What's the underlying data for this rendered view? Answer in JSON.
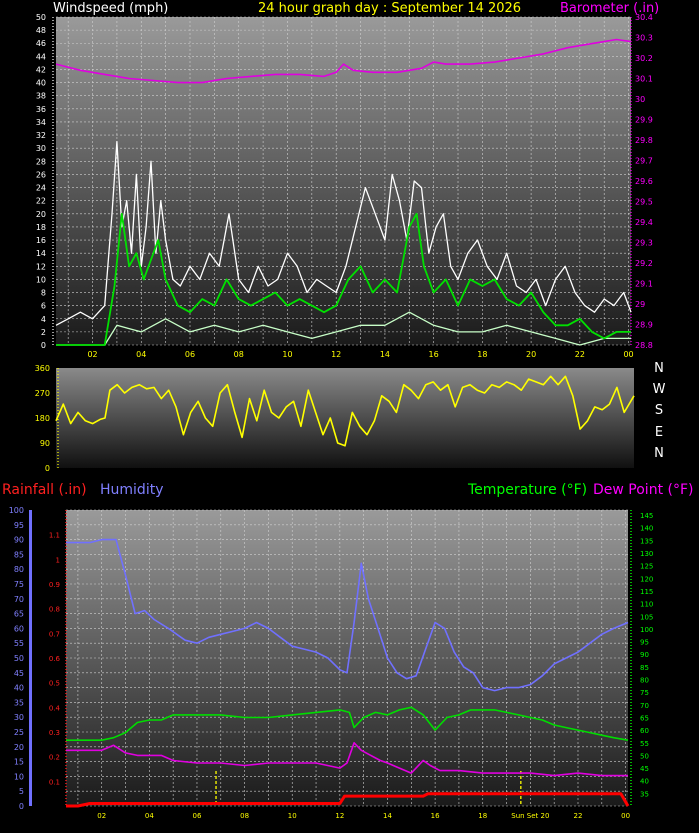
{
  "header": {
    "windspeed_label": "Windspeed (mph)",
    "graph_title": "24 hour graph day : September 14 2026",
    "barometer_label": "Barometer (.in)"
  },
  "compass": [
    "N",
    "W",
    "S",
    "E",
    "N"
  ],
  "legend2": {
    "rainfall": "Rainfall (.in)",
    "humidity": "Humidity",
    "temperature": "Temperature (°F)",
    "dewpoint": "Dew Point (°F)"
  },
  "colors": {
    "windspeed": "#ffffff",
    "windgust_avg": "#00e000",
    "wind_min": "#c8ffc8",
    "barometer": "#e000e0",
    "direction": "#ffff00",
    "humidity": "#7070ff",
    "temperature": "#00dd00",
    "dewpoint": "#e000e0",
    "rainfall": "#ff0000",
    "left_axis": "#ff5050",
    "label_white": "#ffffff",
    "label_yellow": "#ffff00",
    "label_magenta": "#ff00ff",
    "label_blue": "#8080ff",
    "label_green": "#00ff00",
    "label_red": "#ff2020"
  },
  "chart_data": [
    {
      "type": "line",
      "id": "wind-barometer",
      "x_tick_labels": [
        "02",
        "04",
        "06",
        "08",
        "10",
        "12",
        "14",
        "16",
        "18",
        "20",
        "22",
        "00"
      ],
      "xlim_hours": [
        0.5,
        24.1
      ],
      "y_left": {
        "label": "Windspeed (mph)",
        "ylim": [
          0,
          50
        ],
        "ticks": [
          0,
          2,
          4,
          6,
          8,
          10,
          12,
          14,
          16,
          18,
          20,
          22,
          24,
          26,
          28,
          30,
          32,
          34,
          36,
          38,
          40,
          42,
          44,
          46,
          48,
          50
        ]
      },
      "y_right": {
        "label": "Barometer (.in)",
        "ylim": [
          28.8,
          30.4
        ],
        "ticks": [
          28.8,
          28.9,
          29,
          29.1,
          29.2,
          29.3,
          29.4,
          29.5,
          29.6,
          29.7,
          29.8,
          29.9,
          30,
          30.1,
          30.2,
          30.3,
          30.4
        ],
        "tick_labels": [
          "28.8",
          "28.9",
          "29",
          "29.1",
          "29.2",
          "29.3",
          "29.4",
          "29.5",
          "29.6",
          "29.7",
          "29.8",
          "29.9",
          "30",
          "30.1",
          "30.2",
          "30.3",
          "30.4"
        ]
      },
      "series": [
        {
          "key": "barometer",
          "axis": "right",
          "x": [
            0.5,
            1.5,
            2.5,
            3.5,
            4.5,
            5.5,
            6.5,
            7.5,
            8.5,
            9.5,
            10.5,
            11.5,
            12.0,
            12.3,
            12.7,
            13.5,
            14.5,
            15.5,
            16.0,
            16.5,
            17.5,
            18.5,
            19.5,
            20.5,
            21.5,
            22.5,
            23.0,
            23.5,
            24.1
          ],
          "y": [
            30.17,
            30.14,
            30.12,
            30.1,
            30.09,
            30.08,
            30.08,
            30.1,
            30.11,
            30.12,
            30.12,
            30.11,
            30.13,
            30.17,
            30.14,
            30.13,
            30.13,
            30.15,
            30.18,
            30.17,
            30.17,
            30.18,
            30.2,
            30.22,
            30.25,
            30.27,
            30.28,
            30.29,
            30.28
          ]
        },
        {
          "key": "windspeed",
          "axis": "left",
          "x": [
            0.5,
            1.0,
            1.5,
            2.0,
            2.5,
            2.8,
            3.0,
            3.2,
            3.4,
            3.6,
            3.8,
            4.0,
            4.2,
            4.4,
            4.6,
            4.8,
            5.0,
            5.3,
            5.6,
            6.0,
            6.4,
            6.8,
            7.2,
            7.6,
            8.0,
            8.4,
            8.8,
            9.2,
            9.6,
            10.0,
            10.4,
            10.8,
            11.2,
            11.6,
            12.0,
            12.4,
            12.8,
            13.2,
            13.6,
            14.0,
            14.3,
            14.6,
            14.9,
            15.2,
            15.5,
            15.8,
            16.1,
            16.4,
            16.7,
            17.0,
            17.4,
            17.8,
            18.2,
            18.6,
            19.0,
            19.4,
            19.8,
            20.2,
            20.6,
            21.0,
            21.4,
            21.8,
            22.2,
            22.6,
            23.0,
            23.4,
            23.8,
            24.1
          ],
          "y": [
            3,
            4,
            5,
            4,
            6,
            20,
            31,
            18,
            22,
            14,
            26,
            12,
            18,
            28,
            14,
            22,
            16,
            10,
            9,
            12,
            10,
            14,
            12,
            20,
            10,
            8,
            12,
            9,
            10,
            14,
            12,
            8,
            10,
            9,
            8,
            12,
            18,
            24,
            20,
            16,
            26,
            22,
            16,
            25,
            24,
            14,
            18,
            20,
            12,
            10,
            14,
            16,
            12,
            10,
            14,
            9,
            8,
            10,
            6,
            10,
            12,
            8,
            6,
            5,
            7,
            6,
            8,
            5
          ]
        },
        {
          "key": "windgust_avg",
          "axis": "left",
          "x": [
            0.5,
            1.5,
            2.5,
            2.9,
            3.2,
            3.5,
            3.8,
            4.1,
            4.4,
            4.7,
            5.0,
            5.5,
            6.0,
            6.5,
            7.0,
            7.5,
            8.0,
            8.5,
            9.0,
            9.5,
            10.0,
            10.5,
            11.0,
            11.5,
            12.0,
            12.5,
            13.0,
            13.5,
            14.0,
            14.5,
            15.0,
            15.3,
            15.6,
            16.0,
            16.5,
            17.0,
            17.5,
            18.0,
            18.5,
            19.0,
            19.5,
            20.0,
            20.5,
            21.0,
            21.5,
            22.0,
            22.5,
            23.0,
            23.5,
            24.1
          ],
          "y": [
            0,
            0,
            0,
            9,
            20,
            12,
            14,
            10,
            13,
            16,
            10,
            6,
            5,
            7,
            6,
            10,
            7,
            6,
            7,
            8,
            6,
            7,
            6,
            5,
            6,
            10,
            12,
            8,
            10,
            8,
            18,
            20,
            12,
            8,
            10,
            6,
            10,
            9,
            10,
            7,
            6,
            8,
            5,
            3,
            3,
            4,
            2,
            1,
            2,
            2
          ]
        },
        {
          "key": "wind_min",
          "axis": "left",
          "x": [
            0.5,
            2.5,
            3.0,
            4.0,
            5.0,
            6.0,
            7.0,
            8.0,
            9.0,
            10.0,
            11.0,
            12.0,
            13.0,
            14.0,
            15.0,
            16.0,
            17.0,
            18.0,
            19.0,
            20.0,
            21.0,
            22.0,
            23.0,
            24.1
          ],
          "y": [
            0,
            0,
            3,
            2,
            4,
            2,
            3,
            2,
            3,
            2,
            1,
            2,
            3,
            3,
            5,
            3,
            2,
            2,
            3,
            2,
            1,
            0,
            1,
            1
          ]
        }
      ]
    },
    {
      "type": "line",
      "id": "wind-direction",
      "y_ticks": [
        0,
        90,
        180,
        270,
        360
      ],
      "ylim": [
        0,
        360
      ],
      "xlim_hours": [
        0.5,
        24.1
      ],
      "series": [
        {
          "key": "direction",
          "x": [
            0.5,
            0.8,
            1.1,
            1.4,
            1.7,
            2.0,
            2.3,
            2.5,
            2.7,
            3.0,
            3.3,
            3.6,
            3.9,
            4.2,
            4.5,
            4.8,
            5.1,
            5.4,
            5.7,
            6.0,
            6.3,
            6.6,
            6.9,
            7.2,
            7.5,
            7.8,
            8.1,
            8.4,
            8.7,
            9.0,
            9.3,
            9.6,
            9.9,
            10.2,
            10.5,
            10.8,
            11.1,
            11.4,
            11.7,
            12.0,
            12.3,
            12.6,
            12.9,
            13.2,
            13.5,
            13.8,
            14.1,
            14.4,
            14.7,
            15.0,
            15.3,
            15.6,
            15.9,
            16.2,
            16.5,
            16.8,
            17.1,
            17.4,
            17.7,
            18.0,
            18.3,
            18.6,
            18.9,
            19.2,
            19.5,
            19.8,
            20.1,
            20.4,
            20.7,
            21.0,
            21.3,
            21.6,
            21.9,
            22.2,
            22.5,
            22.8,
            23.1,
            23.4,
            23.7,
            24.1
          ],
          "y": [
            170,
            230,
            160,
            200,
            170,
            160,
            175,
            180,
            280,
            300,
            270,
            290,
            300,
            285,
            290,
            250,
            280,
            220,
            120,
            200,
            240,
            180,
            150,
            270,
            300,
            200,
            110,
            250,
            170,
            280,
            200,
            180,
            220,
            240,
            150,
            280,
            200,
            120,
            180,
            90,
            80,
            200,
            150,
            120,
            170,
            260,
            240,
            200,
            300,
            280,
            250,
            300,
            310,
            280,
            300,
            220,
            290,
            300,
            280,
            270,
            300,
            290,
            310,
            300,
            280,
            320,
            310,
            300,
            330,
            300,
            330,
            260,
            140,
            170,
            220,
            210,
            230,
            290,
            200,
            260
          ]
        }
      ]
    },
    {
      "type": "line",
      "id": "temp-humidity-rain",
      "x_tick_labels": [
        "02",
        "04",
        "06",
        "08",
        "10",
        "12",
        "14",
        "16",
        "18",
        "Sun Set 20",
        "22",
        "00"
      ],
      "xlim_hours": [
        0.5,
        24.1
      ],
      "y_humidity": {
        "ylim": [
          0,
          100
        ],
        "ticks": [
          0,
          5,
          10,
          15,
          20,
          25,
          30,
          35,
          40,
          45,
          50,
          55,
          60,
          65,
          70,
          75,
          80,
          85,
          90,
          95,
          100
        ]
      },
      "y_rain": {
        "ylim": [
          0,
          1.2
        ],
        "ticks": [
          0.1,
          0.2,
          0.3,
          0.4,
          0.5,
          0.6,
          0.7,
          0.8,
          0.9
        ],
        "tick_labels": [
          "0.1",
          "0.2",
          "0.3",
          "0.4",
          "0.5",
          "0.6",
          "0.7",
          "0.8",
          "0.9"
        ],
        "extra_ticks": [
          1.0,
          1.1
        ],
        "extra_tick_labels": [
          "1",
          "1.1"
        ]
      },
      "y_temp": {
        "ylim": [
          30,
          147
        ],
        "ticks": [
          35,
          40,
          45,
          50,
          55,
          60,
          65,
          70,
          75,
          80,
          85,
          90,
          95,
          100,
          105,
          110,
          115,
          120,
          125,
          130,
          135,
          140,
          145
        ]
      },
      "markers": [
        {
          "hour": 6.8,
          "label": ""
        },
        {
          "hour": 19.6,
          "label": ""
        }
      ],
      "series": [
        {
          "key": "humidity",
          "axis": "humidity",
          "x": [
            0.5,
            1.5,
            2.0,
            2.6,
            3.0,
            3.4,
            3.8,
            4.2,
            4.8,
            5.5,
            6.0,
            6.5,
            7.0,
            7.5,
            8.0,
            8.5,
            9.0,
            9.5,
            10.0,
            10.5,
            11.0,
            11.5,
            12.0,
            12.3,
            12.6,
            12.9,
            13.2,
            13.6,
            14.0,
            14.4,
            14.8,
            15.2,
            15.6,
            16.0,
            16.4,
            16.8,
            17.2,
            17.6,
            18.0,
            18.5,
            19.0,
            19.5,
            20.0,
            20.5,
            21.0,
            21.5,
            22.0,
            22.5,
            23.0,
            23.5,
            24.1
          ],
          "y": [
            89,
            89,
            90,
            90,
            78,
            65,
            66,
            63,
            60,
            56,
            55,
            57,
            58,
            59,
            60,
            62,
            60,
            57,
            54,
            53,
            52,
            50,
            46,
            45,
            62,
            82,
            70,
            60,
            50,
            45,
            43,
            44,
            53,
            62,
            60,
            52,
            47,
            45,
            40,
            39,
            40,
            40,
            41,
            44,
            48,
            50,
            52,
            55,
            58,
            60,
            62
          ]
        },
        {
          "key": "temperature",
          "axis": "temp",
          "x": [
            0.5,
            1.5,
            2.0,
            2.5,
            3.0,
            3.5,
            4.0,
            4.5,
            5.0,
            6.0,
            7.0,
            8.0,
            9.0,
            10.0,
            11.0,
            12.0,
            12.4,
            12.6,
            13.0,
            13.5,
            14.0,
            14.5,
            15.0,
            15.5,
            16.0,
            16.5,
            17.0,
            17.5,
            18.0,
            18.5,
            19.0,
            19.5,
            20.0,
            20.5,
            21.0,
            21.5,
            22.0,
            22.5,
            23.0,
            23.5,
            24.1
          ],
          "y": [
            56,
            56,
            56,
            57,
            59,
            63,
            64,
            64,
            66,
            66,
            66,
            65,
            65,
            66,
            67,
            68,
            67,
            61,
            65,
            67,
            66,
            68,
            69,
            66,
            60,
            65,
            66,
            68,
            68,
            68,
            67,
            66,
            65,
            64,
            62,
            61,
            60,
            59,
            58,
            57,
            56
          ]
        },
        {
          "key": "dewpoint",
          "axis": "temp",
          "x": [
            0.5,
            1.5,
            2.0,
            2.5,
            3.0,
            3.5,
            4.0,
            4.5,
            5.0,
            6.0,
            7.0,
            8.0,
            9.0,
            10.0,
            11.0,
            12.0,
            12.3,
            12.6,
            12.9,
            13.3,
            13.7,
            14.0,
            14.5,
            15.0,
            15.5,
            15.8,
            16.2,
            17.0,
            18.0,
            19.0,
            20.0,
            21.0,
            22.0,
            23.0,
            24.1
          ],
          "y": [
            52,
            52,
            52,
            54,
            51,
            50,
            50,
            50,
            48,
            47,
            47,
            46,
            47,
            47,
            47,
            45,
            47,
            55,
            52,
            50,
            48,
            47,
            45,
            43,
            48,
            46,
            44,
            44,
            43,
            43,
            43,
            42,
            43,
            42,
            42
          ]
        },
        {
          "key": "rainfall",
          "axis": "rain",
          "x": [
            0.5,
            1.0,
            1.5,
            12.0,
            12.2,
            15.5,
            15.7,
            23.8,
            24.1
          ],
          "y": [
            0.0,
            0.0,
            0.01,
            0.01,
            0.04,
            0.04,
            0.05,
            0.05,
            0.0
          ]
        }
      ]
    }
  ]
}
